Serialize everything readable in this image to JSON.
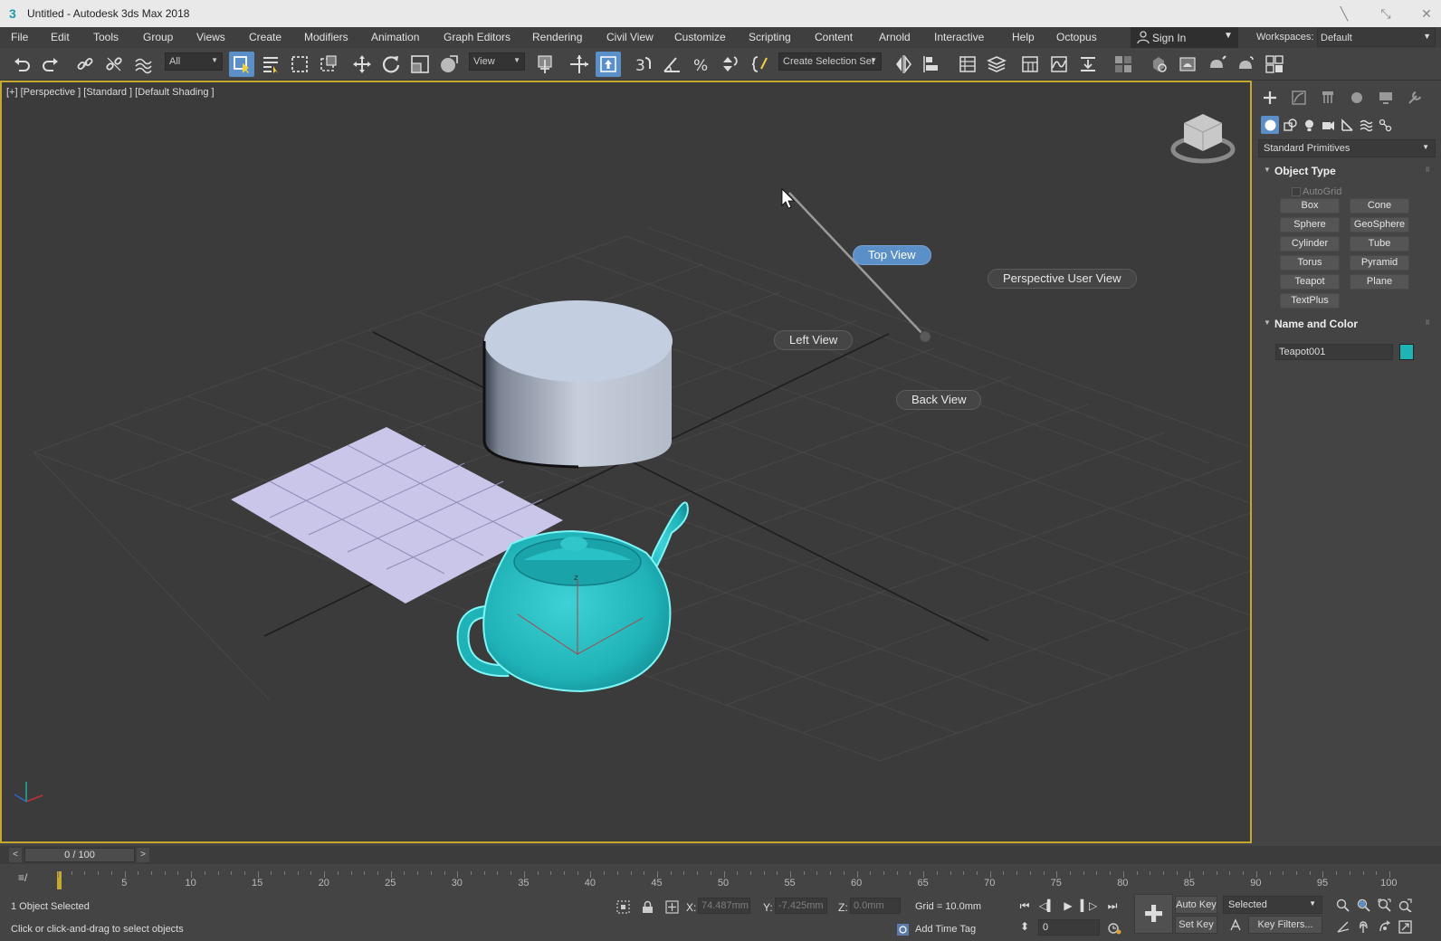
{
  "window": {
    "title": "Untitled - Autodesk 3ds Max 2018",
    "app_icon": "3",
    "buttons": [
      "minimize-icon",
      "maximize-icon",
      "close-icon"
    ]
  },
  "menubar": {
    "items": [
      "File",
      "Edit",
      "Tools",
      "Group",
      "Views",
      "Create",
      "Modifiers",
      "Animation",
      "Graph Editors",
      "Rendering",
      "Civil View",
      "Customize",
      "Scripting",
      "Content",
      "Arnold",
      "Interactive",
      "Help",
      "Octopus"
    ],
    "sign_in": "Sign In",
    "workspaces_label": "Workspaces:",
    "workspaces_value": "Default"
  },
  "toolbar": {
    "selection_filter": "All",
    "reference_coord": "View",
    "named_selection": "Create Selection Set"
  },
  "viewport": {
    "label": "[+] [Perspective ] [Standard ] [Default Shading ]",
    "view_menu": {
      "top": "Top View",
      "perspective_user": "Perspective User View",
      "left": "Left View",
      "back": "Back View",
      "highlighted": "Top View"
    },
    "objects": [
      "plane",
      "cylinder",
      "teapot"
    ],
    "colors": {
      "background": "#3b3b3b",
      "active_border": "#c7a82e",
      "teapot": "#20b8bd",
      "cylinder": "#c3cee0",
      "plane": "#c9c6e9",
      "highlight": "#5b8fc7"
    }
  },
  "command_panel": {
    "category": "Standard Primitives",
    "object_type": {
      "title": "Object Type",
      "autogrid": "AutoGrid",
      "buttons": [
        "Box",
        "Cone",
        "Sphere",
        "GeoSphere",
        "Cylinder",
        "Tube",
        "Torus",
        "Pyramid",
        "Teapot",
        "Plane",
        "TextPlus"
      ]
    },
    "name_and_color": {
      "title": "Name and Color",
      "name": "Teapot001",
      "color": "#20b3b3"
    }
  },
  "timeline": {
    "frame_display": "0 / 100",
    "prev": "<",
    "next": ">",
    "ticks": [
      "0",
      "5",
      "10",
      "15",
      "20",
      "25",
      "30",
      "35",
      "40",
      "45",
      "50",
      "55",
      "60",
      "65",
      "70",
      "75",
      "80",
      "85",
      "90",
      "95",
      "100"
    ]
  },
  "status": {
    "selection": "1 Object Selected",
    "prompt": "Click or click-and-drag to select objects",
    "x_label": "X:",
    "x_value": "74.487mm",
    "y_label": "Y:",
    "y_value": "-7.425mm",
    "z_label": "Z:",
    "z_value": "0.0mm",
    "grid": "Grid = 10.0mm",
    "add_time_tag": "Add Time Tag",
    "auto_key": "Auto Key",
    "set_key": "Set Key",
    "key_mode": "Selected",
    "key_filters": "Key Filters...",
    "current_frame": "0"
  }
}
